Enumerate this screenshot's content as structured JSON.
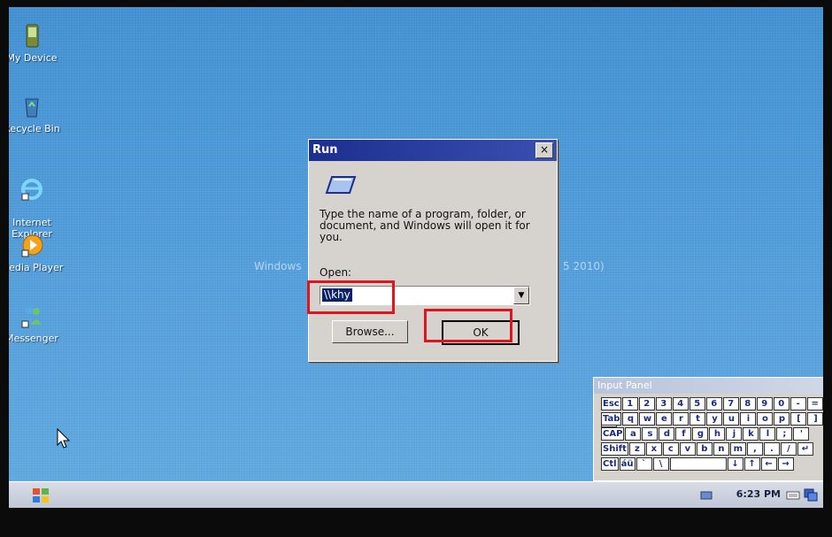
{
  "desktop": {
    "icons": [
      {
        "label": "My Device",
        "icon": "pda-device-icon"
      },
      {
        "label": "Recycle Bin",
        "icon": "recycle-bin-icon"
      },
      {
        "label": "Internet\nExplorer",
        "icon": "internet-explorer-icon"
      },
      {
        "label": "Media Player",
        "icon": "media-player-icon"
      },
      {
        "label": "Messenger",
        "icon": "messenger-icon"
      }
    ],
    "watermark_left": "Windows",
    "watermark_right": "5 2010)"
  },
  "run_dialog": {
    "title": "Run",
    "close_label": "×",
    "message": "Type the name of a program, folder, or document, and Windows will open it for you.",
    "open_label": "Open:",
    "open_value": "\\\\khy",
    "browse_label": "Browse...",
    "ok_label": "OK"
  },
  "input_panel": {
    "title": "Input Panel",
    "rows": [
      [
        "Esc",
        "1",
        "2",
        "3",
        "4",
        "5",
        "6",
        "7",
        "8",
        "9",
        "0",
        "-",
        "=",
        "◆"
      ],
      [
        "Tab",
        "q",
        "w",
        "e",
        "r",
        "t",
        "y",
        "u",
        "i",
        "o",
        "p",
        "[",
        "]"
      ],
      [
        "CAP",
        "a",
        "s",
        "d",
        "f",
        "g",
        "h",
        "j",
        "k",
        "l",
        ";",
        "'"
      ],
      [
        "Shift",
        "z",
        "x",
        "c",
        "v",
        "b",
        "n",
        "m",
        ",",
        ".",
        "/",
        "↵"
      ],
      [
        "Ctl",
        "áü",
        "`",
        "\\",
        " ",
        "↓",
        "↑",
        "←",
        "→"
      ]
    ]
  },
  "taskbar": {
    "clock": "6:23 PM"
  },
  "colors": {
    "highlight_box": "#e0141e",
    "title_bar": "#1c2f8f"
  }
}
